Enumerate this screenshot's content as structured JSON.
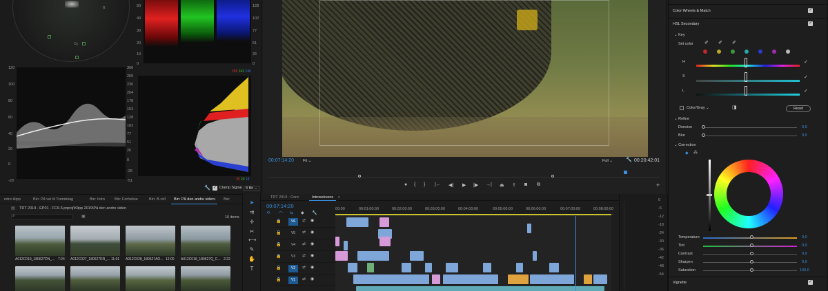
{
  "scopes": {
    "vectorscope_labels": [
      "R",
      "Cy"
    ],
    "waveform_scale": [
      "120",
      "100",
      "80",
      "60",
      "40",
      "20",
      "0",
      "-20"
    ],
    "waveform_scale_right": [
      "306",
      "255",
      "230",
      "204",
      "178",
      "153",
      "128",
      "102",
      "77",
      "51",
      "26",
      "0",
      "-26",
      "-51"
    ],
    "parade_scale": [
      "50",
      "40",
      "30",
      "20",
      "10",
      "0"
    ],
    "parade_scale_right": [
      "128",
      "102",
      "77",
      "51",
      "26",
      "0"
    ],
    "rgb_top": [
      "255",
      "243",
      "240"
    ],
    "rgb_bottom": [
      "25",
      "20",
      "18"
    ],
    "clamp_label": "Clamp Signal",
    "bit_depth": "8 Bit"
  },
  "program": {
    "timecode_in": "00:07:14:20",
    "fit_label": "Fit",
    "full_label": "Full",
    "timecode_out": "00:20:42:01"
  },
  "bins": {
    "tabs": [
      "ndre klipp",
      "Bin: På vei til Trøndelag",
      "Bin: Intro",
      "Bin: Forhekse",
      "Bin: B-roll",
      "Bin: På den andre siden",
      "Bin:"
    ],
    "path": "TRT 2019 - EP01 - FC6-6.prproj\\Klipp 2019\\På den andre siden",
    "item_count": "16 items",
    "clips": [
      {
        "name": "A012C019_180627DN_...",
        "dur": "7:24"
      },
      {
        "name": "A012C027_180627RR_...",
        "dur": "11:01"
      },
      {
        "name": "A012C028_180627AO...",
        "dur": "12:00"
      },
      {
        "name": "A012C018_180627Q_C...",
        "dur": "2:22"
      }
    ]
  },
  "timeline": {
    "tabs": [
      "TRT 2019 - Core",
      "Introsekvens"
    ],
    "timecode": "00:07:14:20",
    "ruler": [
      "00:00",
      "00:01:00:00",
      "00:02:00:00",
      "00:03:00:00",
      "00:04:00:00",
      "00:05:00:00",
      "00:06:00:00",
      "00:07:00:00",
      "00:08:00:00"
    ],
    "tracks": [
      "V6",
      "V5",
      "V4",
      "V3",
      "V2",
      "V1"
    ],
    "db_scale": [
      "0",
      "-6",
      "-12",
      "-18",
      "-24",
      "-30",
      "-36",
      "-42",
      "-48",
      "-54"
    ]
  },
  "lumetri": {
    "color_wheels": "Color Wheels & Match",
    "hsl": "HSL Secondary",
    "key": "Key",
    "set_color": "Set color",
    "h": "H",
    "s": "S",
    "l": "L",
    "color_gray": "Color/Gray",
    "reset": "Reset",
    "refine": "Refine",
    "denoise": "Denoise",
    "denoise_val": "0,0",
    "blur": "Blur",
    "blur_val": "0,0",
    "correction": "Correction",
    "temperature": "Temperature",
    "temperature_val": "0,0",
    "tint": "Tint",
    "tint_val": "0,0",
    "contrast": "Contrast",
    "contrast_val": "0,0",
    "sharpen": "Sharpen",
    "sharpen_val": "0,0",
    "saturation": "Saturation",
    "saturation_val": "100,0",
    "vignette": "Vignette",
    "swatches": [
      "#c0282b",
      "#b8a82a",
      "#3a9a3a",
      "#2aa7a7",
      "#2a3ccf",
      "#a42aa9",
      "#bbbbbb"
    ]
  }
}
